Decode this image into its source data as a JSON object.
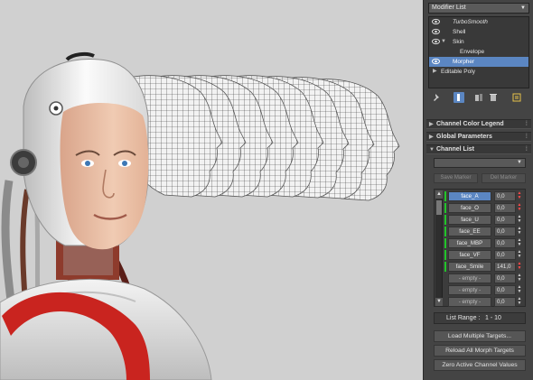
{
  "panel": {
    "modifier_list": {
      "label": "Modifier List"
    },
    "stack": [
      {
        "label": "TurboSmooth",
        "eye": true,
        "expand": "",
        "italic": true,
        "selected": false
      },
      {
        "label": "Shell",
        "eye": true,
        "expand": "",
        "italic": false,
        "selected": false
      },
      {
        "label": "Skin",
        "eye": true,
        "expand": "▼",
        "italic": false,
        "selected": false
      },
      {
        "label": "Envelope",
        "eye": false,
        "expand": "",
        "italic": false,
        "selected": false
      },
      {
        "label": "Morpher",
        "eye": true,
        "expand": "",
        "italic": false,
        "selected": true
      },
      {
        "label": "Editable Poly",
        "eye": false,
        "expand": "▶",
        "italic": false,
        "selected": false
      }
    ],
    "rollouts": {
      "color_legend": "Channel Color Legend",
      "global_params": "Global Parameters",
      "channel_list": "Channel List"
    },
    "save_marker": "Save Marker",
    "del_marker": "Del Marker",
    "channels": [
      {
        "name": "face_A",
        "value": "0,0",
        "active": true,
        "empty": false,
        "highlight": true
      },
      {
        "name": "face_O",
        "value": "0,0",
        "active": false,
        "empty": false,
        "highlight": true
      },
      {
        "name": "face_U",
        "value": "0,0",
        "active": false,
        "empty": false,
        "highlight": false
      },
      {
        "name": "face_EE",
        "value": "0,0",
        "active": false,
        "empty": false,
        "highlight": false
      },
      {
        "name": "face_MBP",
        "value": "0,0",
        "active": false,
        "empty": false,
        "highlight": false
      },
      {
        "name": "face_VF",
        "value": "0,0",
        "active": false,
        "empty": false,
        "highlight": false
      },
      {
        "name": "face_Smile",
        "value": "141,0",
        "active": false,
        "empty": false,
        "highlight": true
      },
      {
        "name": "- empty -",
        "value": "0,0",
        "active": false,
        "empty": true,
        "highlight": false
      },
      {
        "name": "- empty -",
        "value": "0,0",
        "active": false,
        "empty": true,
        "highlight": false
      },
      {
        "name": "- empty -",
        "value": "0,0",
        "active": false,
        "empty": true,
        "highlight": false
      }
    ],
    "list_range": {
      "label": "List Range :",
      "value": "1 - 10"
    },
    "load_targets": "Load Multiple Targets...",
    "reload_targets": "Reload All Morph Targets",
    "zero_values": "Zero Active Channel Values",
    "colors": {
      "selected": "#5b86c2",
      "channel_bar": "#22c42a",
      "spinner_highlight": "#ff4a4a",
      "panel_bg": "#444444"
    }
  }
}
